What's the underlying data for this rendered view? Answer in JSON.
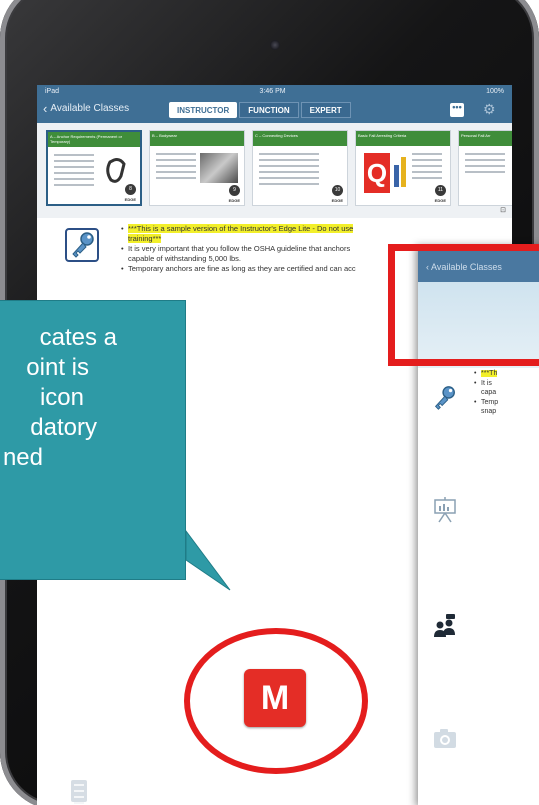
{
  "status_bar": {
    "carrier": "iPad",
    "time": "3:46 PM",
    "battery": "100%"
  },
  "nav": {
    "back_label": "Available Classes",
    "tabs": [
      {
        "label": "INSTRUCTOR",
        "active": true
      },
      {
        "label": "FUNCTION",
        "active": false
      },
      {
        "label": "EXPERT",
        "active": false
      }
    ],
    "more_label": "•••"
  },
  "thumbnails": [
    {
      "title": "A – Anchor Requirements (Permanent or Temporary)",
      "number": "8",
      "selected": true
    },
    {
      "title": "B – Bodywear",
      "number": "9",
      "selected": false
    },
    {
      "title": "C – Connecting Devices",
      "number": "10",
      "selected": false
    },
    {
      "title": "Basic Fall Arresting Criteria",
      "number": "11",
      "selected": false
    },
    {
      "title": "Personal Fall Arr",
      "number": "12",
      "selected": false
    }
  ],
  "thumb_logo": "EDGE",
  "bullets": [
    {
      "highlight": "***This is a sample version of the Instructor's Edge Lite - Do not use",
      "rest": "",
      "second_highlight": "training***"
    },
    {
      "highlight": "",
      "rest": "It is very important that you follow the OSHA guideline that anchors",
      "second_highlight": ""
    },
    {
      "highlight": "",
      "rest": "capable of withstanding 5,000 lbs.",
      "second_highlight": ""
    },
    {
      "highlight": "",
      "rest": "Temporary anchors are fine as long as they are certified and can acc",
      "second_highlight": ""
    }
  ],
  "m_button_label": "M",
  "callout_lines": [
    "cates a",
    "oint is",
    "icon",
    "datory",
    "ned"
  ],
  "overlay": {
    "carrier": "iPad",
    "back_label": "Available Classes",
    "bullets": [
      "***Th",
      "It is",
      "capa",
      "Temp",
      "snap"
    ]
  },
  "colors": {
    "nav_blue": "#3f6f95",
    "callout_teal": "#2e9aa6",
    "highlight_yellow": "#f2ef2a",
    "alert_red": "#e41d1d",
    "m_button_red": "#e42d26"
  }
}
